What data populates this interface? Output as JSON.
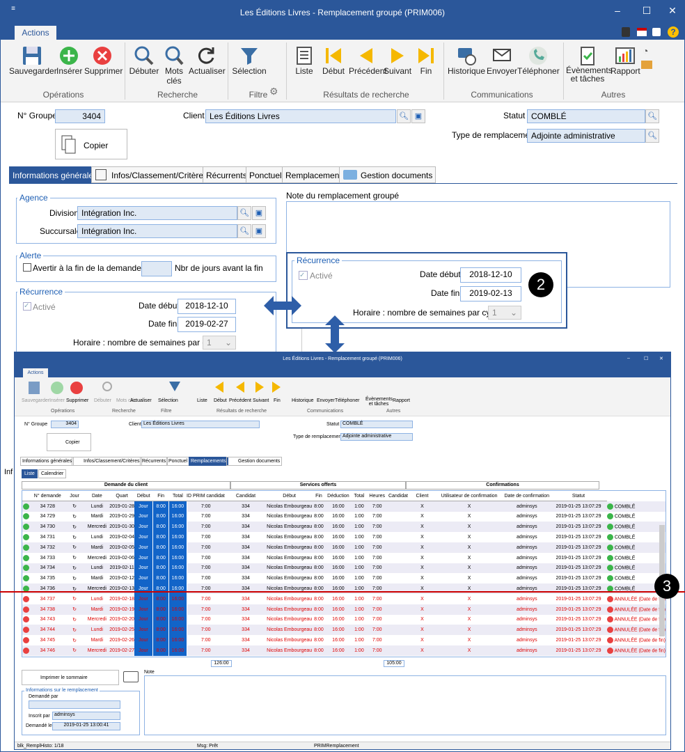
{
  "window": {
    "title": "Les Éditions Livres - Remplacement groupé (PRIM006)"
  },
  "ribbon": {
    "tab": "Actions",
    "buttons": {
      "save": "Sauvegarder",
      "insert": "Insérer",
      "delete": "Supprimer",
      "start": "Débuter",
      "keywords": "Mots clés",
      "refresh": "Actualiser",
      "selection": "Sélection",
      "list": "Liste",
      "first": "Début",
      "previous": "Précédent",
      "next": "Suivant",
      "last": "Fin",
      "history": "Historique",
      "send": "Envoyer",
      "phone": "Téléphoner",
      "events": "Évènements et tâches",
      "report": "Rapport"
    },
    "groups": {
      "operations": "Opérations",
      "search": "Recherche",
      "filter": "Filtre",
      "results": "Résultats de recherche",
      "communications": "Communications",
      "others": "Autres"
    }
  },
  "form": {
    "group_no_label": "N° Groupe",
    "group_no": "3404",
    "client_label": "Client",
    "client": "Les Éditions Livres",
    "status_label": "Statut",
    "status": "COMBLÉ",
    "type_label": "Type de remplacement",
    "type": "Adjointe administrative",
    "copy": "Copier"
  },
  "tabs": [
    "Informations générales",
    "Infos/Classement/Critères",
    "Récurrents",
    "Ponctuel",
    "Remplacements",
    "Gestion documents"
  ],
  "agency": {
    "title": "Agence",
    "division_label": "Division",
    "division": "Intégration Inc.",
    "branch_label": "Succursale",
    "branch": "Intégration Inc."
  },
  "alert": {
    "title": "Alerte",
    "check": "Avertir à la fin de la demande",
    "days_label": "Nbr de jours avant la fin"
  },
  "recurrence": {
    "title": "Récurrence",
    "active": "Activé",
    "start_label": "Date début",
    "start": "2018-12-10",
    "end_label": "Date fin",
    "end": "2019-02-27",
    "cycle_label": "Horaire : nombre de semaines par cycle",
    "cycle": "1"
  },
  "recurrence2": {
    "title": "Récurrence",
    "active": "Activé",
    "start_label": "Date début",
    "start": "2018-12-10",
    "end_label": "Date fin",
    "end": "2019-02-13",
    "cycle_label": "Horaire : nombre de semaines par cycle",
    "cycle": "1"
  },
  "note_label": "Note du remplacement groupé",
  "callouts": {
    "c2": "2",
    "c3": "3"
  },
  "inner": {
    "title": "Les Éditions Livres - Remplacement groupé (PRIM006)",
    "subtabs": [
      "Liste",
      "Calendrier"
    ],
    "sections": [
      "Demande du client",
      "Services offerts",
      "Confirmations"
    ],
    "columns": [
      "N° demande",
      "Jour",
      "Date",
      "Quart",
      "Début",
      "Fin",
      "Total",
      "ID PRIM candidat",
      "Candidat",
      "Début",
      "Fin",
      "Déduction",
      "Total",
      "Heures",
      "Candidat",
      "Client",
      "Utilisateur de confirmation",
      "Date de confirmation",
      "Statut"
    ],
    "rows": [
      [
        "34 728",
        "Lundi",
        "2019-01-28",
        "COMBLÉ"
      ],
      [
        "34 729",
        "Mardi",
        "2019-01-29",
        "COMBLÉ"
      ],
      [
        "34 730",
        "Mercredi",
        "2019-01-30",
        "COMBLÉ"
      ],
      [
        "34 731",
        "Lundi",
        "2019-02-04",
        "COMBLÉ"
      ],
      [
        "34 732",
        "Mardi",
        "2019-02-05",
        "COMBLÉ"
      ],
      [
        "34 733",
        "Mercredi",
        "2019-02-06",
        "COMBLÉ"
      ],
      [
        "34 734",
        "Lundi",
        "2019-02-11",
        "COMBLÉ"
      ],
      [
        "34 735",
        "Mardi",
        "2019-02-12",
        "COMBLÉ"
      ],
      [
        "34 736",
        "Mercredi",
        "2019-02-13",
        "COMBLÉ"
      ],
      [
        "34 737",
        "Lundi",
        "2019-02-18",
        "ANNULÉE (Date de fin)"
      ],
      [
        "34 738",
        "Mardi",
        "2019-02-19",
        "ANNULÉE (Date de fin)"
      ],
      [
        "34 743",
        "Mercredi",
        "2019-02-20",
        "ANNULÉE (Date de fin)"
      ],
      [
        "34 744",
        "Lundi",
        "2019-02-25",
        "ANNULÉE (Date de fin)"
      ],
      [
        "34 745",
        "Mardi",
        "2019-02-26",
        "ANNULÉE (Date de fin)"
      ],
      [
        "34 746",
        "Mercredi",
        "2019-02-27",
        "ANNULÉE (Date de fin)"
      ]
    ],
    "shift": "Jour",
    "start": "8:00",
    "end": "16:00",
    "total": "7:00",
    "prim_id": "334",
    "candidate": "Nicolas Embourgeau",
    "deduction": "1:00",
    "x": "X",
    "user": "adminsys",
    "conf_date": "2019-01-25 13:07:29",
    "sum1": "126:00",
    "sum2": "105:00",
    "print": "Imprimer le sommaire",
    "note": "Note",
    "info_title": "Informations sur le remplacement",
    "asked_by": "Demandé par",
    "written_by": "Inscrit par",
    "written_val": "adminsys",
    "asked_on": "Demandé le",
    "asked_on_val": "2019-01-25 13:00:41",
    "status_bar": [
      "blk_RemplHisto: 1/18",
      "Msg: Prêt",
      "PRIMRemplacement"
    ]
  }
}
